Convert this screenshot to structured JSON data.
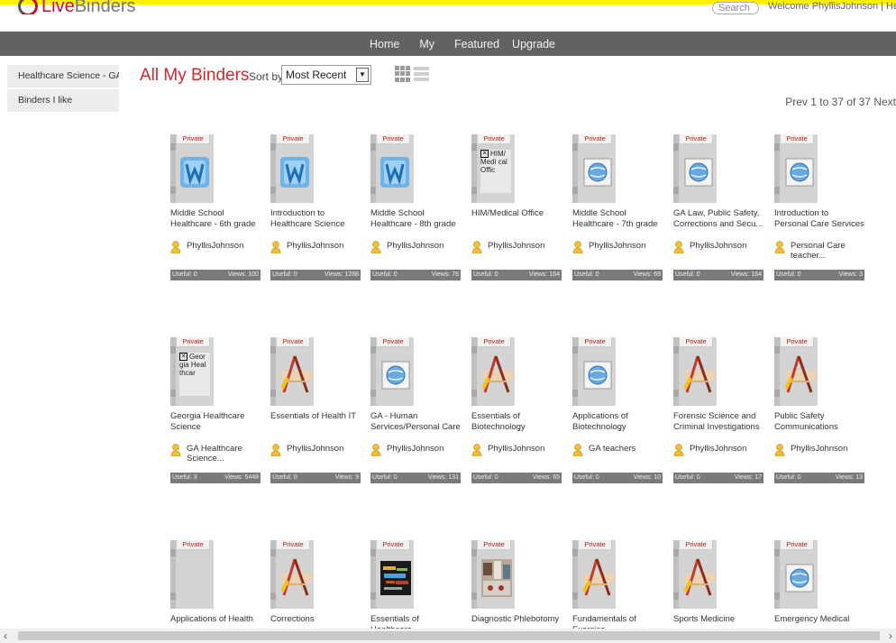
{
  "header": {
    "logo_text_strong": "Live",
    "logo_text_light": "Binders",
    "search_placeholder": "Search",
    "welcome_text": "Welcome PhyllisJohnson | Help",
    "accent_color": "#c8102e",
    "top_bar_color": "#ffef00"
  },
  "nav": {
    "items": [
      {
        "label": "Home"
      },
      {
        "label": "My"
      },
      {
        "label": "Featured"
      },
      {
        "label": "Upgrade"
      }
    ]
  },
  "sidebar": {
    "items": [
      {
        "label": "Healthcare Science - GA"
      },
      {
        "label": "Binders I like"
      }
    ]
  },
  "toolbar": {
    "title": "All My Binders",
    "sort_label": "Sort by:",
    "sort_value": "Most Recent",
    "pagination": "Prev 1 to 37 of 37 Next"
  },
  "binders": [
    {
      "title": "Middle School Healthcare - 6th grade",
      "owner": "PhyllisJohnson",
      "useful": "Useful: 0",
      "views": "Views: 100",
      "private": "Private",
      "thumb": "word-icon"
    },
    {
      "title": "Introduction to Healthcare Science",
      "owner": "PhyllisJohnson",
      "useful": "Useful: 0",
      "views": "Views: 1288",
      "private": "Private",
      "thumb": "word-icon"
    },
    {
      "title": "Middle School Healthcare - 8th grade",
      "owner": "PhyllisJohnson",
      "useful": "Useful: 0",
      "views": "Views: 76",
      "private": "Private",
      "thumb": "word-icon"
    },
    {
      "title": "HIM/Medical Office",
      "owner": "PhyllisJohnson",
      "useful": "Useful: 0",
      "views": "Views: 164",
      "private": "Private",
      "thumb": "text",
      "thumb_text": "HIM/ Medi cal Offic"
    },
    {
      "title": "Middle School Healthcare - 7th grade",
      "owner": "PhyllisJohnson",
      "useful": "Useful: 0",
      "views": "Views: 69",
      "private": "Private",
      "thumb": "web-icon"
    },
    {
      "title": "GA Law, Public Safety, Corrections and Secu...",
      "owner": "PhyllisJohnson",
      "useful": "Useful: 0",
      "views": "Views: 164",
      "private": "Private",
      "thumb": "web-icon"
    },
    {
      "title": "Introduction to Personal Care Services",
      "owner": "Personal Care teacher...",
      "useful": "Useful: 0",
      "views": "Views: 3",
      "private": "Private",
      "thumb": "web-icon"
    },
    {
      "title": "Georgia Healthcare Science",
      "owner": "GA Healthcare Science...",
      "useful": "Useful: 3",
      "views": "Views: 5448",
      "private": "Private",
      "thumb": "text",
      "thumb_text": "Geor gia Heal thcar"
    },
    {
      "title": "Essentials of Health IT",
      "owner": "PhyllisJohnson",
      "useful": "Useful: 0",
      "views": "Views: 9",
      "private": "Private",
      "thumb": "pencil-icon"
    },
    {
      "title": "GA - Human Services/Personal Care",
      "owner": "PhyllisJohnson",
      "useful": "Useful: 0",
      "views": "Views: 131",
      "private": "Private",
      "thumb": "web-icon"
    },
    {
      "title": "Essentials of Biotechnology",
      "owner": "PhyllisJohnson",
      "useful": "Useful: 0",
      "views": "Views: 65",
      "private": "Private",
      "thumb": "pencil-icon"
    },
    {
      "title": "Applications of Biotechnology",
      "owner": "GA teachers",
      "useful": "Useful: 0",
      "views": "Views: 10",
      "private": "Private",
      "thumb": "web-icon"
    },
    {
      "title": "Forensic Science and Criminal Investigations",
      "owner": "PhyllisJohnson",
      "useful": "Useful: 0",
      "views": "Views: 17",
      "private": "Private",
      "thumb": "pencil-icon"
    },
    {
      "title": "Public Safety Communications",
      "owner": "PhyllisJohnson",
      "useful": "Useful: 0",
      "views": "Views: 13",
      "private": "Private",
      "thumb": "pencil-icon"
    },
    {
      "title": "Applications of Health",
      "owner": "",
      "useful": "",
      "views": "",
      "private": "Private",
      "thumb": "blank"
    },
    {
      "title": "Corrections",
      "owner": "",
      "useful": "",
      "views": "",
      "private": "Private",
      "thumb": "pencil-icon"
    },
    {
      "title": "Essentials of Healthcare",
      "owner": "",
      "useful": "",
      "views": "",
      "private": "Private",
      "thumb": "wordcloud-image"
    },
    {
      "title": "Diagnostic Phlebotomy",
      "owner": "",
      "useful": "",
      "views": "",
      "private": "Private",
      "thumb": "photo-image"
    },
    {
      "title": "Fundamentals of Exercise",
      "owner": "",
      "useful": "",
      "views": "",
      "private": "Private",
      "thumb": "pencil-icon"
    },
    {
      "title": "Sports Medicine",
      "owner": "",
      "useful": "",
      "views": "",
      "private": "Private",
      "thumb": "pencil-icon"
    },
    {
      "title": "Emergency Medical",
      "owner": "",
      "useful": "",
      "views": "",
      "private": "Private",
      "thumb": "web-icon"
    }
  ],
  "scrollbar": {
    "left_arrow": "‹",
    "right_arrow": "›"
  }
}
